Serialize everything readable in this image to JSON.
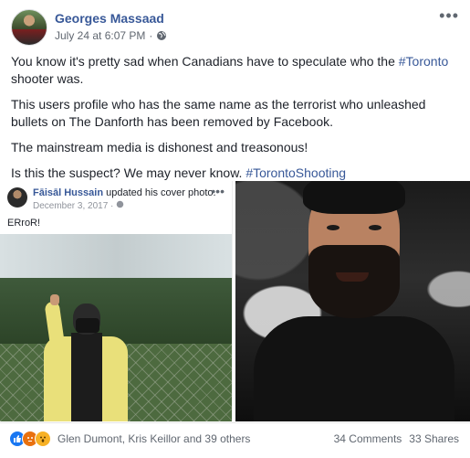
{
  "post": {
    "author": "Georges Massaad",
    "timestamp": "July 24 at 6:07 PM",
    "separator": "·",
    "paragraphs": [
      {
        "text": "You know it's pretty sad when Canadians have to speculate who the ",
        "hashtag": "#Toronto",
        "after": " shooter was."
      },
      {
        "text": "This users profile who has the same name as the terrorist who unleashed bullets on The Danforth has been removed by Facebook.",
        "hashtag": "",
        "after": ""
      },
      {
        "text": "The mainstream media is dishonest and treasonous!",
        "hashtag": "",
        "after": ""
      },
      {
        "text": "Is this the suspect? We may never know. ",
        "hashtag": "#TorontoShooting",
        "after": ""
      }
    ]
  },
  "embedded": {
    "name": "Fāisāl Hussain",
    "action": " updated his cover photo.",
    "date": "December 3, 2017 · ",
    "caption": "ERroR!"
  },
  "footer": {
    "reaction_names": "Glen Dumont, Kris Keillor and 39 others",
    "comments": "34 Comments",
    "shares": "33 Shares"
  },
  "icons": {
    "reactions": [
      "like-icon",
      "angry-icon",
      "wow-icon"
    ],
    "privacy": "globe-icon",
    "more": "ellipsis-icon"
  },
  "colors": {
    "link": "#385898",
    "text": "#1d2129",
    "meta": "#606770",
    "like": "#1877f2",
    "angry": "#e9710f",
    "wow": "#f7b125"
  }
}
